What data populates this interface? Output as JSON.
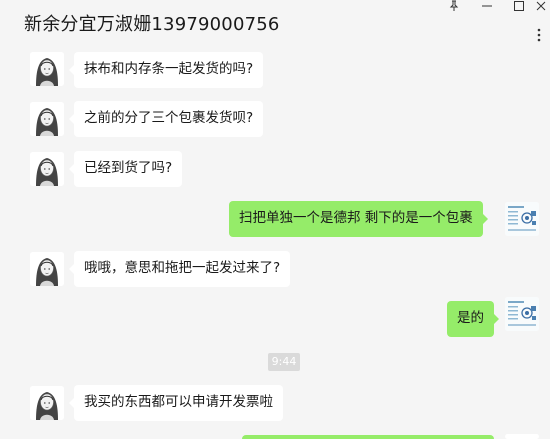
{
  "window": {
    "title": "新余分宜万淑姗13979000756",
    "controls": {
      "pin": "†",
      "minimize": "—",
      "maximize": "□",
      "close": "✕",
      "more": "⋯"
    }
  },
  "messages": [
    {
      "side": "left",
      "text": "抹布和内存条一起发货的吗?"
    },
    {
      "side": "left",
      "text": "之前的分了三个包裹发货呗?"
    },
    {
      "side": "left",
      "text": "已经到货了吗?"
    },
    {
      "side": "right",
      "text": "扫把单独一个是德邦  剩下的是一个包裹"
    },
    {
      "side": "left",
      "text": "哦哦，意思和拖把一起发过来了?"
    },
    {
      "side": "right",
      "text": "是的"
    },
    {
      "side": "time",
      "text": "9:44"
    },
    {
      "side": "left",
      "text": "我买的东西都可以申请开发票啦"
    }
  ],
  "colors": {
    "background": "#f5f5f5",
    "bubble_self": "#95ec69",
    "bubble_other": "#ffffff",
    "timestamp_bg": "#dadada"
  }
}
